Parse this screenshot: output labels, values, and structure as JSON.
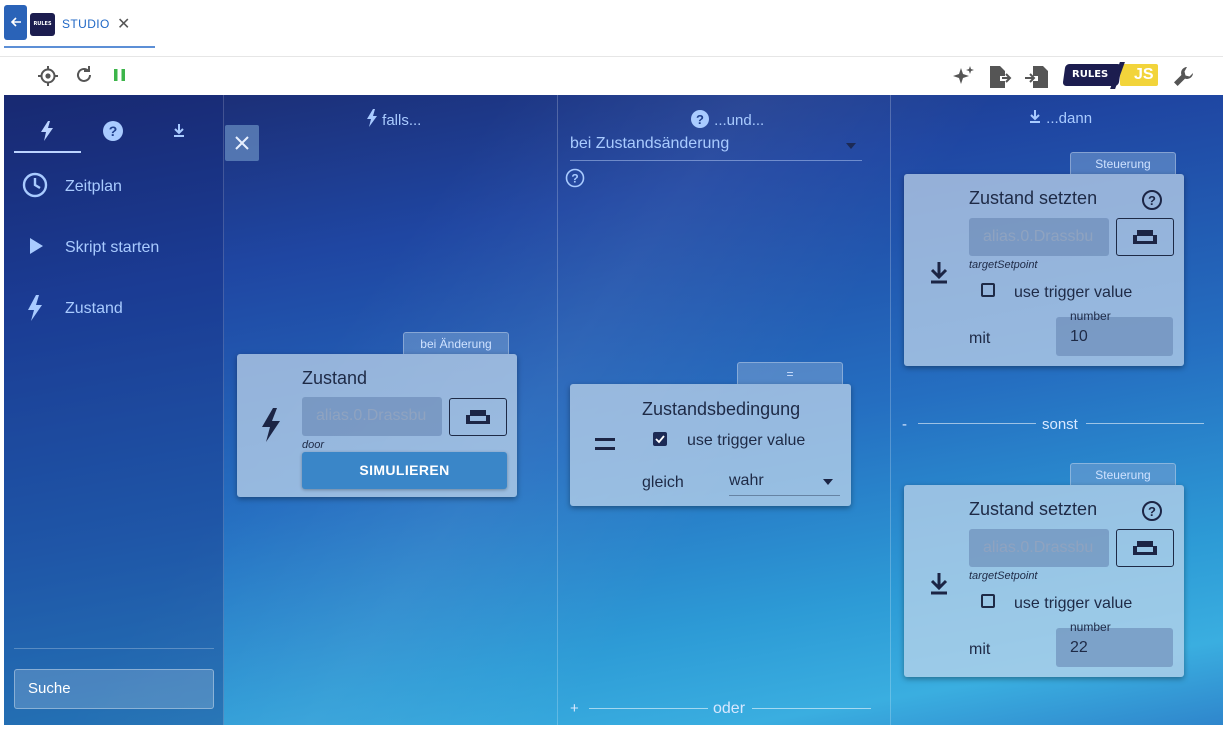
{
  "tab": {
    "logo_text": "RULES",
    "label": "STUDIO",
    "close": "✕"
  },
  "toolbar": {
    "brand_logo_text": "RULES",
    "brand_js_text": "JS"
  },
  "sidebar": {
    "items": [
      {
        "label": "Zeitplan",
        "icon": "clock-icon"
      },
      {
        "label": "Skript starten",
        "icon": "play-icon"
      },
      {
        "label": "Zustand",
        "icon": "lightning-icon"
      }
    ],
    "search_value": "Suche"
  },
  "columns": {
    "falls": "falls...",
    "und": "...und...",
    "dann": "...dann"
  },
  "trigger_card": {
    "badge": "bei Änderung",
    "title": "Zustand",
    "object_id": "alias.0.Drassbu",
    "object_caption": "door",
    "simulate": "SIMULIEREN"
  },
  "condition": {
    "dropdown_value": "bei Zustandsänderung",
    "badge": "=",
    "title": "Zustandsbedingung",
    "use_trigger": "use trigger value",
    "use_trigger_checked": true,
    "compare_label": "gleich",
    "compare_value": "wahr",
    "or_label": "oder",
    "plus": "+"
  },
  "actions": [
    {
      "badge": "Steuerung",
      "title": "Zustand setzten",
      "object_id": "alias.0.Drassbu",
      "object_caption": "targetSetpoint",
      "use_trigger": "use trigger value",
      "use_trigger_checked": false,
      "with_label": "mit",
      "number_caption": "number",
      "number_value": "10"
    },
    {
      "badge": "Steuerung",
      "title": "Zustand setzten",
      "object_id": "alias.0.Drassbu",
      "object_caption": "targetSetpoint",
      "use_trigger": "use trigger value",
      "use_trigger_checked": false,
      "with_label": "mit",
      "number_caption": "number",
      "number_value": "22"
    }
  ],
  "else_section": {
    "minus": "-",
    "label": "sonst"
  },
  "colors": {
    "accent": "#2a63b8",
    "pause_green": "#3cb54a",
    "brand_js_yellow": "#f2d43b",
    "brand_dark": "#1c1d4f"
  }
}
